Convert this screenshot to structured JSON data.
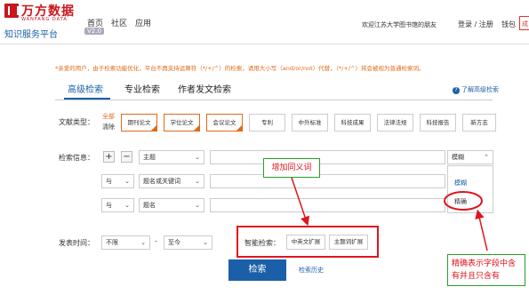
{
  "logo": {
    "cn": "万方数据",
    "en": "WANFANG DATA"
  },
  "platform": {
    "title": "知识服务平台",
    "badge": "V2.0"
  },
  "nav": {
    "items": [
      "首页",
      "社区",
      "应用"
    ]
  },
  "user": {
    "welcome": "欢迎江苏大学图书馆的朋友",
    "login": "登录 / 注册",
    "wallet": "钱包",
    "cut_label": "成"
  },
  "notice": "*亲爱的用户，由于检索功能优化，平台不再支持运算符（*/+/^）的检索，请用大小写（and/or/not）代替，（*/+/^）将会被视为普通检索词。",
  "tabs": [
    "高级检索",
    "专业检索",
    "作者发文检索"
  ],
  "help": "了解高级检索",
  "doc_type": {
    "label": "文献类型：",
    "all": "全部",
    "clear": "清除",
    "chips": [
      "期刊论文",
      "学位论文",
      "会议论文",
      "专利",
      "中外标准",
      "科技成果",
      "法律法规",
      "科技报告",
      "新方志"
    ]
  },
  "search_info": {
    "label": "检索信息：",
    "plus": "+",
    "minus": "−",
    "rows": [
      {
        "logic": "",
        "field": "主题",
        "match": "模糊"
      },
      {
        "logic": "与",
        "field": "题名或关键词",
        "match": ""
      },
      {
        "logic": "与",
        "field": "题名",
        "match": ""
      }
    ],
    "dropdown_options": [
      "模糊",
      "精确"
    ]
  },
  "publish_time": {
    "label": "发表时间：",
    "from": "不限",
    "dash": "-",
    "to": "至今"
  },
  "smart": {
    "label": "智能检索：",
    "buttons": [
      "中英文扩展",
      "主题词扩展"
    ]
  },
  "search_button": "检索",
  "history_link": "检索历史",
  "annotations": {
    "synonym": "增加同义词",
    "exact_note": "精确表示字段中含有并且只含有"
  },
  "colors": {
    "brand_red": "#c8161d",
    "link_blue": "#1b5fa8",
    "notice_orange": "#e06a1a",
    "annotation_red": "#e0141e",
    "annotation_green": "#2a9d2a"
  }
}
